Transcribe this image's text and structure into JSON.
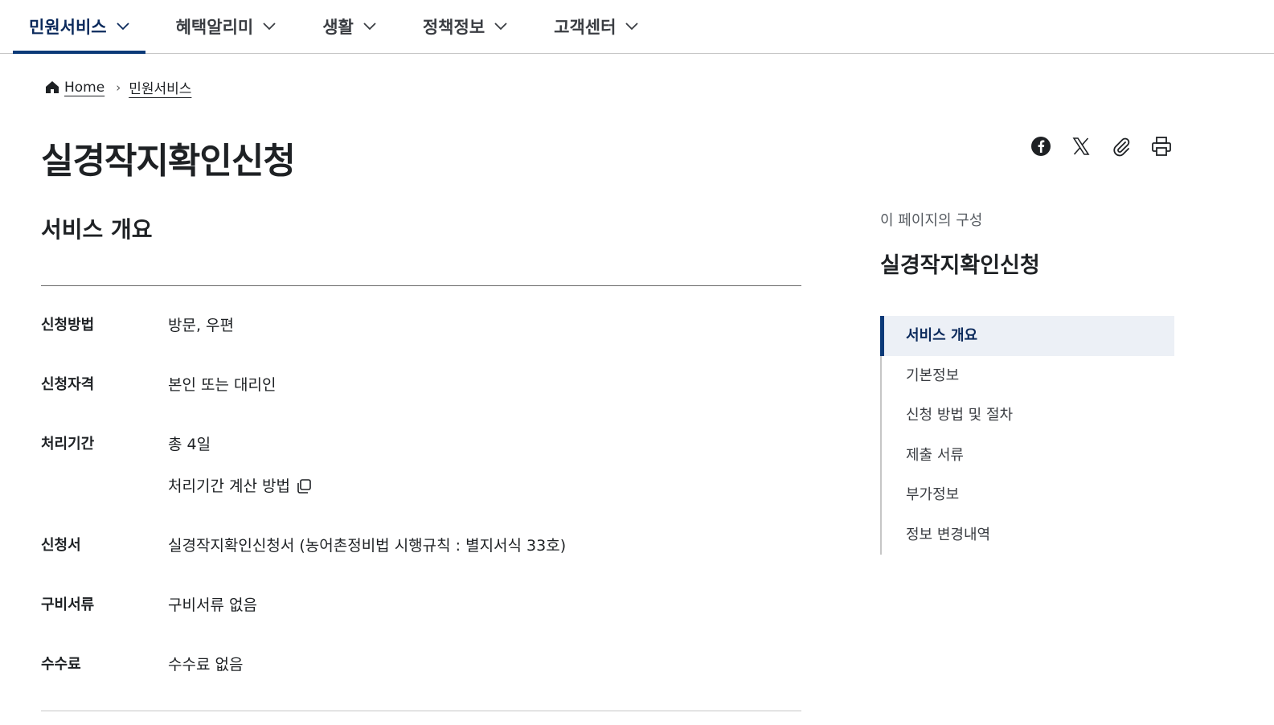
{
  "nav": {
    "items": [
      {
        "label": "민원서비스",
        "active": true
      },
      {
        "label": "혜택알리미",
        "active": false
      },
      {
        "label": "생활",
        "active": false
      },
      {
        "label": "정책정보",
        "active": false
      },
      {
        "label": "고객센터",
        "active": false
      }
    ]
  },
  "breadcrumb": {
    "home": "Home",
    "current": "민원서비스"
  },
  "page": {
    "title": "실경작지확인신청"
  },
  "share": {
    "icons": [
      "facebook-icon",
      "x-icon",
      "paperclip-icon",
      "printer-icon"
    ]
  },
  "overview": {
    "title": "서비스 개요",
    "rows": [
      {
        "label": "신청방법",
        "value": "방문, 우편"
      },
      {
        "label": "신청자격",
        "value": "본인 또는 대리인"
      },
      {
        "label": "처리기간",
        "value": "총 4일",
        "link": "처리기간 계산 방법"
      },
      {
        "label": "신청서",
        "value": "실경작지확인신청서 (농어촌정비법 시행규칙 : 별지서식 33호)"
      },
      {
        "label": "구비서류",
        "value": "구비서류 없음"
      },
      {
        "label": "수수료",
        "value": "수수료 없음"
      }
    ]
  },
  "toc": {
    "caption": "이 페이지의 구성",
    "title": "실경작지확인신청",
    "items": [
      {
        "label": "서비스 개요",
        "active": true
      },
      {
        "label": "기본정보",
        "active": false
      },
      {
        "label": "신청 방법 및 절차",
        "active": false
      },
      {
        "label": "제출 서류",
        "active": false
      },
      {
        "label": "부가정보",
        "active": false
      },
      {
        "label": "정보 변경내역",
        "active": false
      }
    ]
  },
  "colors": {
    "accent": "#0b3a78",
    "active_bg": "#ecf0f6",
    "text": "#1e2124"
  }
}
